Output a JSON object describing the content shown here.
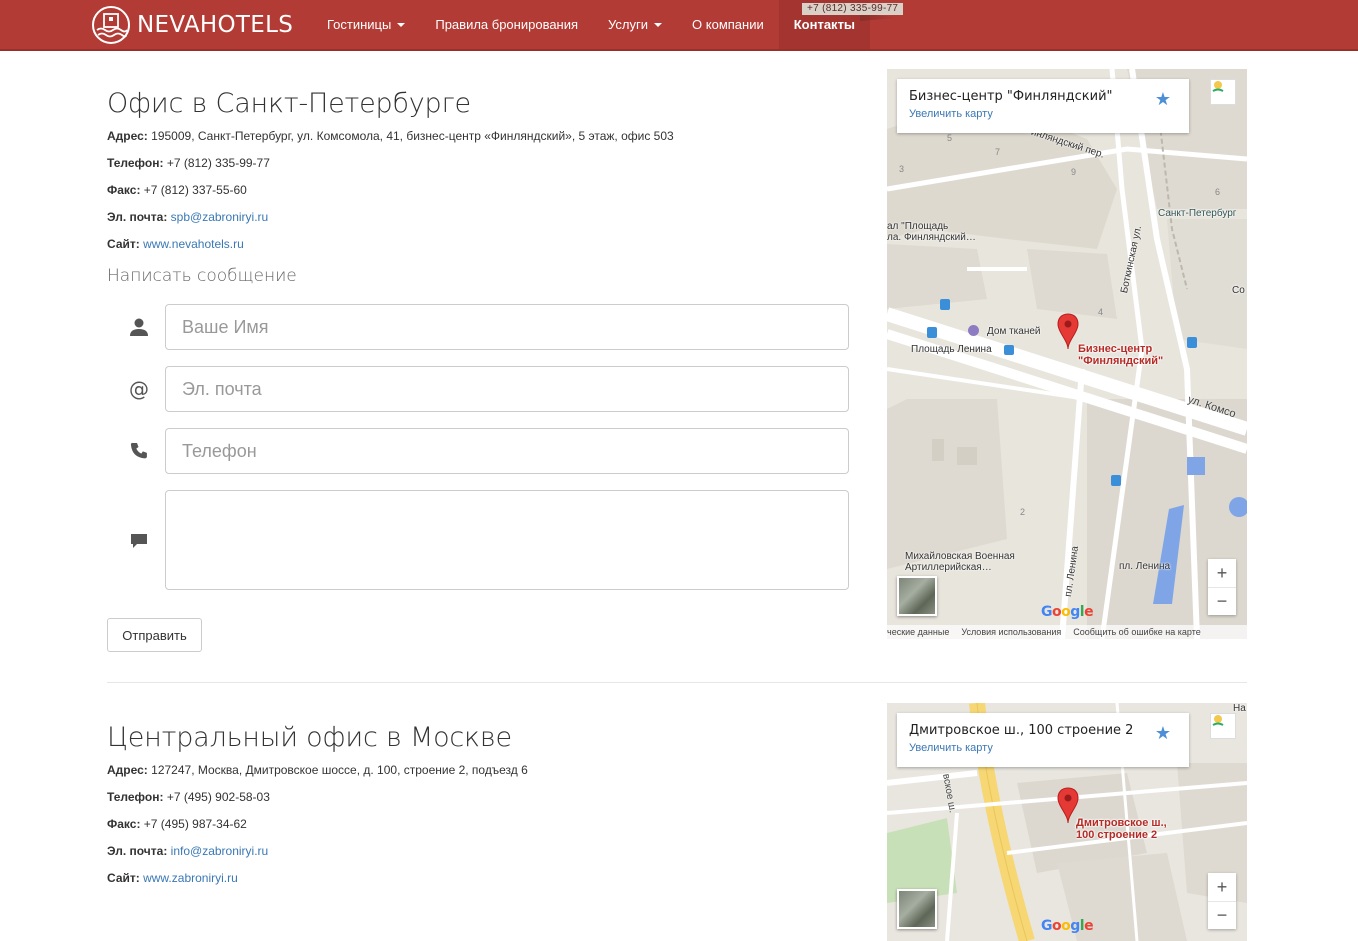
{
  "brand": {
    "name": "NEVAHOTELS"
  },
  "nav": {
    "items": [
      {
        "label": "Гостиницы",
        "dropdown": true
      },
      {
        "label": "Правила бронирования",
        "dropdown": false
      },
      {
        "label": "Услуги",
        "dropdown": true
      },
      {
        "label": "О компании",
        "dropdown": false
      },
      {
        "label": "Контакты",
        "dropdown": false,
        "active": true
      }
    ],
    "phone_badge": "+7 (812) 335-99-77"
  },
  "spb": {
    "title": "Офис в Санкт-Петербурге",
    "address_label": "Адрес:",
    "address": "195009, Санкт-Петербург, ул. Комсомола, 41, бизнес-центр «Финляндский», 5 этаж, офис 503",
    "phone_label": "Телефон:",
    "phone": "+7 (812) 335-99-77",
    "fax_label": "Факс:",
    "fax": "+7 (812) 337-55-60",
    "email_label": "Эл. почта:",
    "email": "spb@zabroniryi.ru",
    "site_label": "Сайт:",
    "site": "www.nevahotels.ru"
  },
  "form": {
    "title": "Написать сообщение",
    "name_placeholder": "Ваше Имя",
    "email_placeholder": "Эл. почта",
    "phone_placeholder": "Телефон",
    "message_placeholder": "",
    "submit_label": "Отправить",
    "email_icon_glyph": "@"
  },
  "map_spb": {
    "card_title": "Бизнес-центр \"Финляндский\"",
    "card_link": "Увеличить карту",
    "pin_label_1": "Бизнес-центр",
    "pin_label_2": "\"Финляндский\"",
    "labels": {
      "finl_per": "Финляндский пер.",
      "spb": "Санкт-Петербург",
      "vokzal_1": "ал \"Площадь",
      "vokzal_2": "ла. Финляндский…",
      "dom_tkaney": "Дом тканей",
      "pl_lenina": "Площадь Ленина",
      "botk": "Боткинская ул.",
      "komsom": "ул. Комсо",
      "co": "Co",
      "mikh_1": "Михайловская Военная",
      "mikh_2": "Артиллерийская…",
      "pr_lenina": "пл. Ленина",
      "pl_lenina2": "пл. Ленина"
    },
    "numbers": [
      "5",
      "7",
      "3",
      "9",
      "6",
      "4",
      "2"
    ],
    "footer": [
      "ческие данные",
      "Условия использования",
      "Сообщить об ошибке на карте"
    ],
    "zoom_in": "+",
    "zoom_out": "−",
    "google": [
      "G",
      "o",
      "o",
      "g",
      "l",
      "e"
    ]
  },
  "msk": {
    "title": "Центральный офис в Москве",
    "address_label": "Адрес:",
    "address": "127247, Москва, Дмитровское шоссе, д. 100, строение 2, подъезд 6",
    "phone_label": "Телефон:",
    "phone": "+7 (495) 902-58-03",
    "fax_label": "Факс:",
    "fax": "+7 (495) 987-34-62",
    "email_label": "Эл. почта:",
    "email": "info@zabroniryi.ru",
    "site_label": "Сайт:",
    "site": "www.zabroniryi.ru"
  },
  "map_msk": {
    "card_title": "Дмитровское ш., 100 строение 2",
    "card_link": "Увеличить карту",
    "pin_label_1": "Дмитровское ш.,",
    "pin_label_2": "100 строение 2",
    "labels": {
      "dmitr": "вское ш.",
      "na": "На"
    },
    "zoom_in": "+",
    "zoom_out": "−",
    "google": [
      "G",
      "o",
      "o",
      "g",
      "l",
      "e"
    ]
  },
  "colors": {
    "header": "#b33b35",
    "link": "#3a78b5",
    "pin": "#e53935"
  }
}
